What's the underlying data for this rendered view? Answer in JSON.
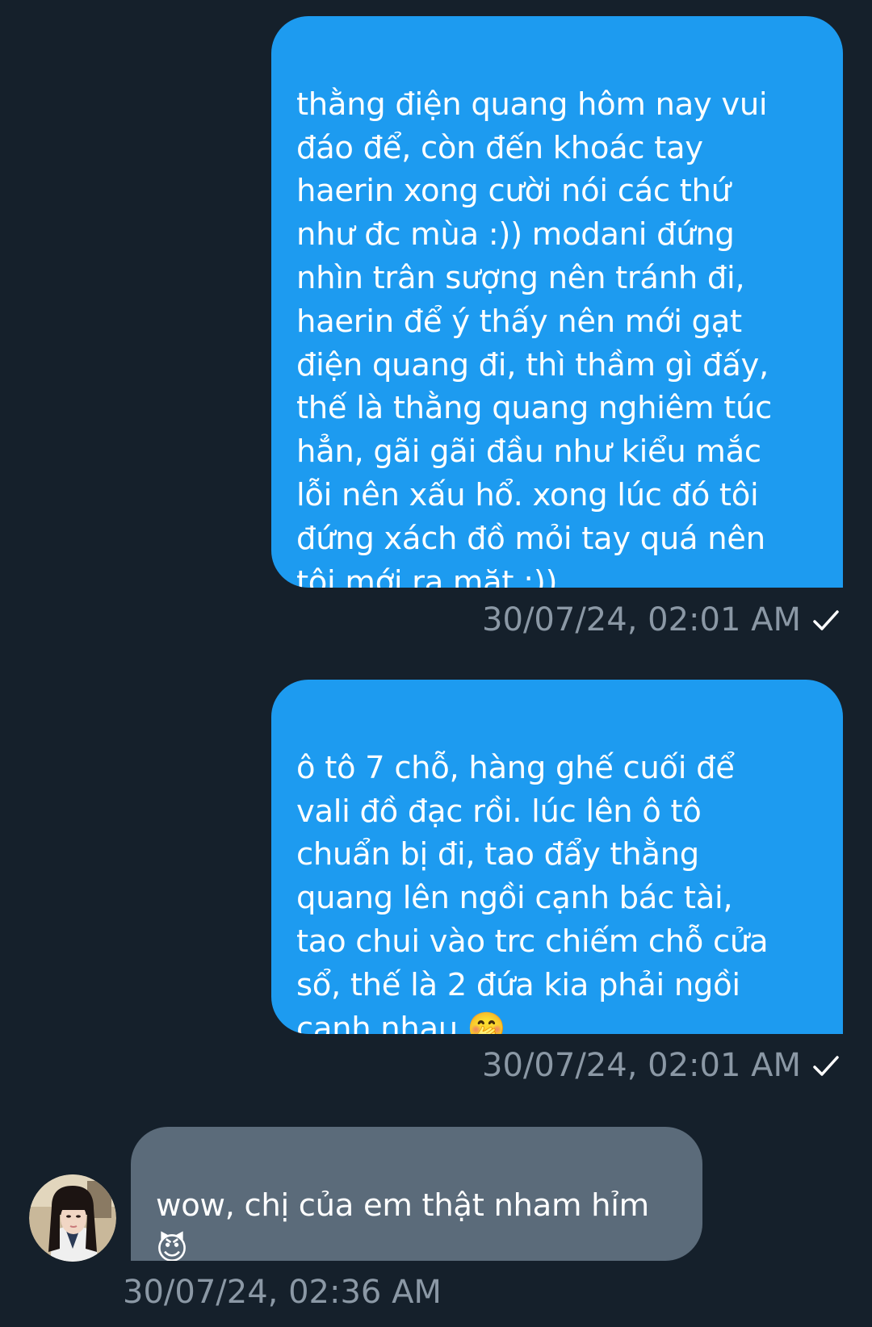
{
  "conversation": {
    "messages": [
      {
        "sender": "me",
        "text": "thằng điện quang hôm nay vui\nđáo để, còn đến khoác tay\nhaerin xong cười nói các thứ\nnhư đc mùa :)) modani đứng\nnhìn trân sượng nên tránh đi,\nhaerin để ý thấy nên mới gạt\nđiện quang đi, thì thầm gì đấy,\nthế là thằng quang nghiêm túc\nhẳn, gãi gãi đầu như kiểu mắc\nlỗi nên xấu hổ. xong lúc đó tôi\nđứng xách đồ mỏi tay quá nên\ntôi mới ra mặt :))",
        "timestamp": "30/07/24, 02:01 AM",
        "status_icon": "check-icon"
      },
      {
        "sender": "me",
        "text": "ô tô 7 chỗ, hàng ghế cuối để\nvali đồ đạc rồi. lúc lên ô tô\nchuẩn bị đi, tao đẩy thằng\nquang lên ngồi cạnh bác tài,\ntao chui vào trc chiếm chỗ cửa\nsổ, thế là 2 đứa kia phải ngồi\ncạnh nhau 🤭",
        "timestamp": "30/07/24, 02:01 AM",
        "status_icon": "check-icon"
      },
      {
        "sender": "other",
        "text": "wow, chị của em thật nham hỉm\n😈",
        "timestamp": "30/07/24, 02:36 AM",
        "avatar_icon": "user-avatar"
      }
    ]
  },
  "colors": {
    "background": "#15202b",
    "sent_bubble": "#1d9bf0",
    "received_bubble": "#5b6b7a",
    "timestamp": "#8b98a5",
    "text": "#ffffff"
  }
}
